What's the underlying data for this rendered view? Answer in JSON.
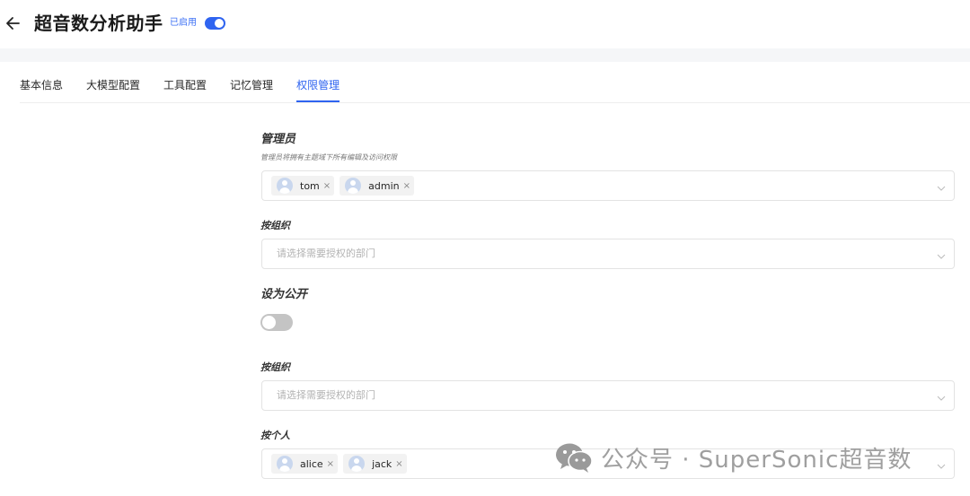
{
  "header": {
    "title": "超音数分析助手",
    "status_label": "已启用",
    "enabled": true
  },
  "tabs": [
    {
      "label": "基本信息",
      "active": false
    },
    {
      "label": "大模型配置",
      "active": false
    },
    {
      "label": "工具配置",
      "active": false
    },
    {
      "label": "记忆管理",
      "active": false
    },
    {
      "label": "权限管理",
      "active": true
    }
  ],
  "admins": {
    "title": "管理员",
    "subtitle": "管理员将拥有主题域下所有编辑及访问权限",
    "tags": [
      {
        "name": "tom",
        "remove": "×"
      },
      {
        "name": "admin",
        "remove": "×"
      }
    ]
  },
  "org_admin": {
    "title": "按组织",
    "placeholder": "请选择需要授权的部门"
  },
  "public": {
    "title": "设为公开",
    "enabled": false
  },
  "org_view": {
    "title": "按组织",
    "placeholder": "请选择需要授权的部门"
  },
  "person_view": {
    "title": "按个人",
    "tags": [
      {
        "name": "alice",
        "remove": "×"
      },
      {
        "name": "jack",
        "remove": "×"
      }
    ]
  },
  "watermark": {
    "text": "公众号 · SuperSonic超音数"
  },
  "colors": {
    "accent": "#2f64f0",
    "toggle_off": "#c4c4c4",
    "band": "#f5f6f8"
  }
}
